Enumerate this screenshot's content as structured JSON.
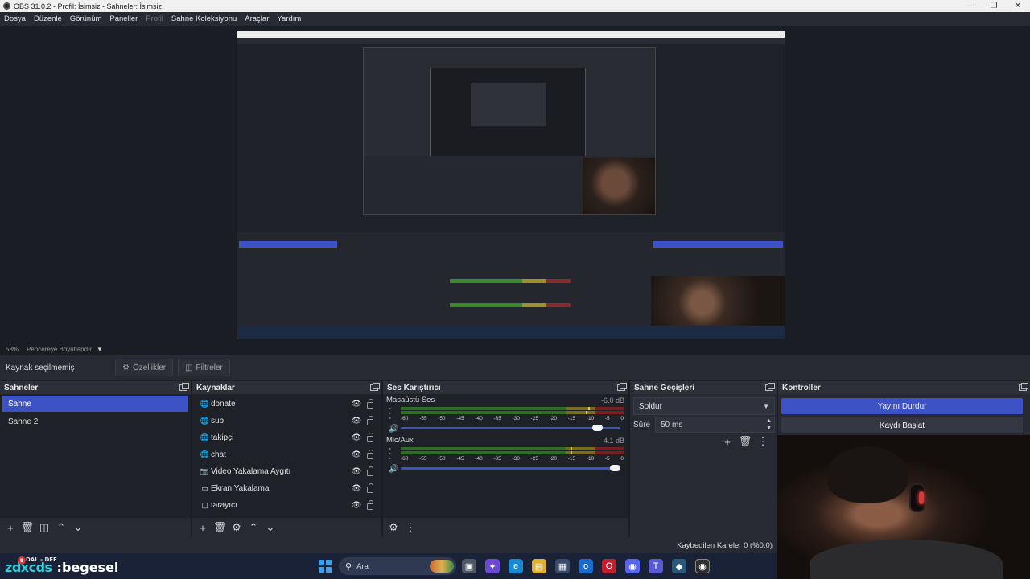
{
  "window": {
    "title": "OBS 31.0.2 - Profil: İsimsiz - Sahneler: İsimsiz"
  },
  "menu": [
    "Dosya",
    "Düzenle",
    "Görünüm",
    "Paneller",
    "Profil",
    "Sahne Koleksiyonu",
    "Araçlar",
    "Yardım"
  ],
  "menu_disabled": "Profil",
  "preview": {
    "zoom": "53%",
    "mode": "Pencereye Boyutlandır"
  },
  "propbar": {
    "no_source": "Kaynak seçilmemiş",
    "properties": "Özellikler",
    "filters": "Filtreler"
  },
  "scenes": {
    "title": "Sahneler",
    "items": [
      "Sahne",
      "Sahne 2"
    ],
    "selected": "Sahne"
  },
  "sources": {
    "title": "Kaynaklar",
    "items": [
      {
        "name": "donate",
        "icon": "browser-icon"
      },
      {
        "name": "sub",
        "icon": "browser-icon"
      },
      {
        "name": "takipçi",
        "icon": "browser-icon"
      },
      {
        "name": "chat",
        "icon": "browser-icon"
      },
      {
        "name": "Video Yakalama Aygıtı",
        "icon": "camera-icon"
      },
      {
        "name": "Ekran Yakalama",
        "icon": "monitor-icon"
      },
      {
        "name": "tarayıcı",
        "icon": "window-icon"
      }
    ]
  },
  "mixer": {
    "title": "Ses Karıştırıcı",
    "scale": [
      "-60",
      "-55",
      "-50",
      "-45",
      "-40",
      "-35",
      "-30",
      "-25",
      "-20",
      "-15",
      "-10",
      "-5",
      "0"
    ],
    "channels": [
      {
        "name": "Masaüstü Ses",
        "db": "-6.0 dB",
        "volume": 0.92
      },
      {
        "name": "Mic/Aux",
        "db": "4.1 dB",
        "volume": 1.0
      }
    ]
  },
  "transitions": {
    "title": "Sahne Geçişleri",
    "selected": "Soldur",
    "duration_label": "Süre",
    "duration_value": "50 ms"
  },
  "controls": {
    "title": "Kontroller",
    "stop_stream": "Yayını Durdur",
    "start_record": "Kaydı Başlat"
  },
  "status": {
    "dropped_frames": "Kaybedilen Kareler 0 (%0.0)"
  },
  "taskbar": {
    "brand": "zdxcds",
    "overlay_text": "DAL - DEF",
    "badge": "8",
    "name": ":begesel",
    "search_placeholder": "Ara"
  },
  "colors": {
    "accent": "#3d52c4",
    "panel": "#272a33",
    "background": "#1b1d24"
  }
}
